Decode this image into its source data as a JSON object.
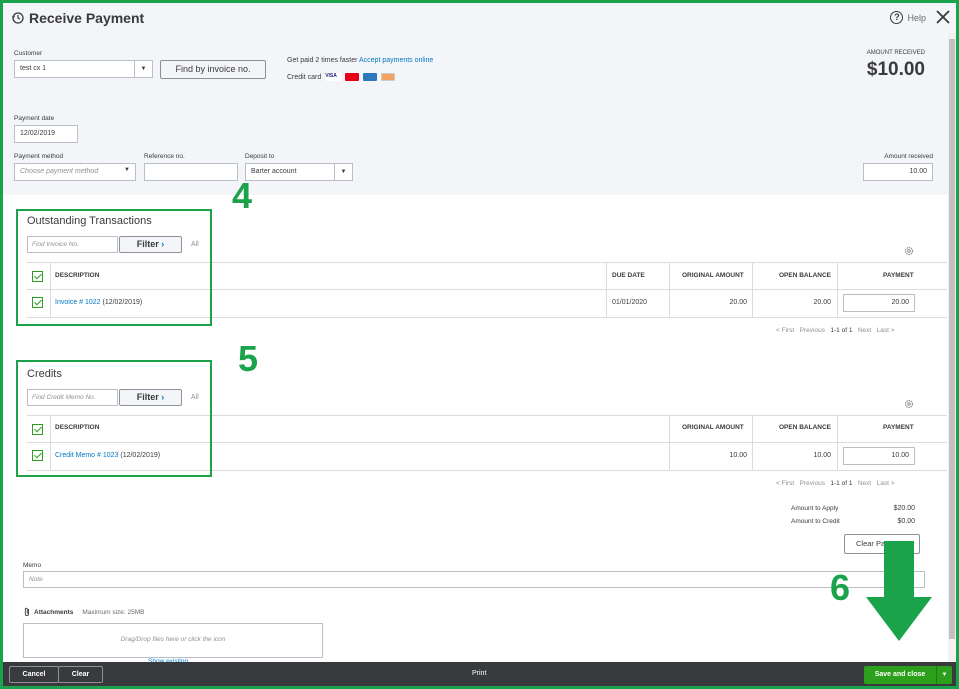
{
  "window": {
    "title": "Receive Payment",
    "help_label": "Help"
  },
  "customer": {
    "label": "Customer",
    "value": "test cx 1",
    "find_button": "Find by invoice no."
  },
  "promo": {
    "text": "Get paid 2 times faster",
    "link": "Accept payments online",
    "credit_label": "Credit card",
    "cards": [
      "VISA",
      "mastercard",
      "amex",
      "discover"
    ]
  },
  "amount": {
    "label": "AMOUNT RECEIVED",
    "value": "$10.00"
  },
  "payment_date": {
    "label": "Payment date",
    "value": "12/02/2019"
  },
  "payment_method": {
    "label": "Payment method",
    "placeholder": "Choose payment method"
  },
  "reference": {
    "label": "Reference no.",
    "value": ""
  },
  "deposit": {
    "label": "Deposit to",
    "value": "Barter account"
  },
  "amount_received": {
    "label": "Amount received",
    "value": "10.00"
  },
  "outstanding": {
    "title": "Outstanding Transactions",
    "search_placeholder": "Find Invoice No.",
    "filter_label": "Filter",
    "all_label": "All",
    "headers": {
      "description": "DESCRIPTION",
      "due_date": "DUE DATE",
      "original": "ORIGINAL AMOUNT",
      "open": "OPEN BALANCE",
      "payment": "PAYMENT"
    },
    "rows": [
      {
        "link": "Invoice # 1022",
        "date": "(12/02/2019)",
        "due_date": "01/01/2020",
        "original": "20.00",
        "open": "20.00",
        "payment": "20.00"
      }
    ],
    "pager": {
      "first": "< First",
      "previous": "Previous",
      "range": "1-1 of 1",
      "next": "Next",
      "last": "Last >"
    }
  },
  "credits": {
    "title": "Credits",
    "search_placeholder": "Find Credit Memo No.",
    "filter_label": "Filter",
    "all_label": "All",
    "headers": {
      "description": "DESCRIPTION",
      "original": "ORIGINAL AMOUNT",
      "open": "OPEN BALANCE",
      "payment": "PAYMENT"
    },
    "rows": [
      {
        "link": "Credit Memo # 1023",
        "date": "(12/02/2019)",
        "original": "10.00",
        "open": "10.00",
        "payment": "10.00"
      }
    ],
    "pager": {
      "first": "< First",
      "previous": "Previous",
      "range": "1-1 of 1",
      "next": "Next",
      "last": "Last >"
    }
  },
  "totals": {
    "apply_label": "Amount to Apply",
    "apply_value": "$20.00",
    "credit_label": "Amount to Credit",
    "credit_value": "$0.00",
    "clear_button": "Clear Pa"
  },
  "memo": {
    "label": "Memo",
    "placeholder": "Note"
  },
  "attachments": {
    "label": "Attachments",
    "max_size": "Maximum size: 25MB",
    "drop_text": "Drag/Drop files here or click the icon",
    "show_existing": "Show existing"
  },
  "annotations": {
    "step4": "4",
    "step5": "5",
    "step6": "6"
  },
  "footer": {
    "cancel": "Cancel",
    "clear": "Clear",
    "print": "Print",
    "save_close": "Save and close"
  },
  "colors": {
    "green": "#1aa34a",
    "link": "#0077c5",
    "footer": "#393a3d",
    "save": "#2ca01c"
  }
}
